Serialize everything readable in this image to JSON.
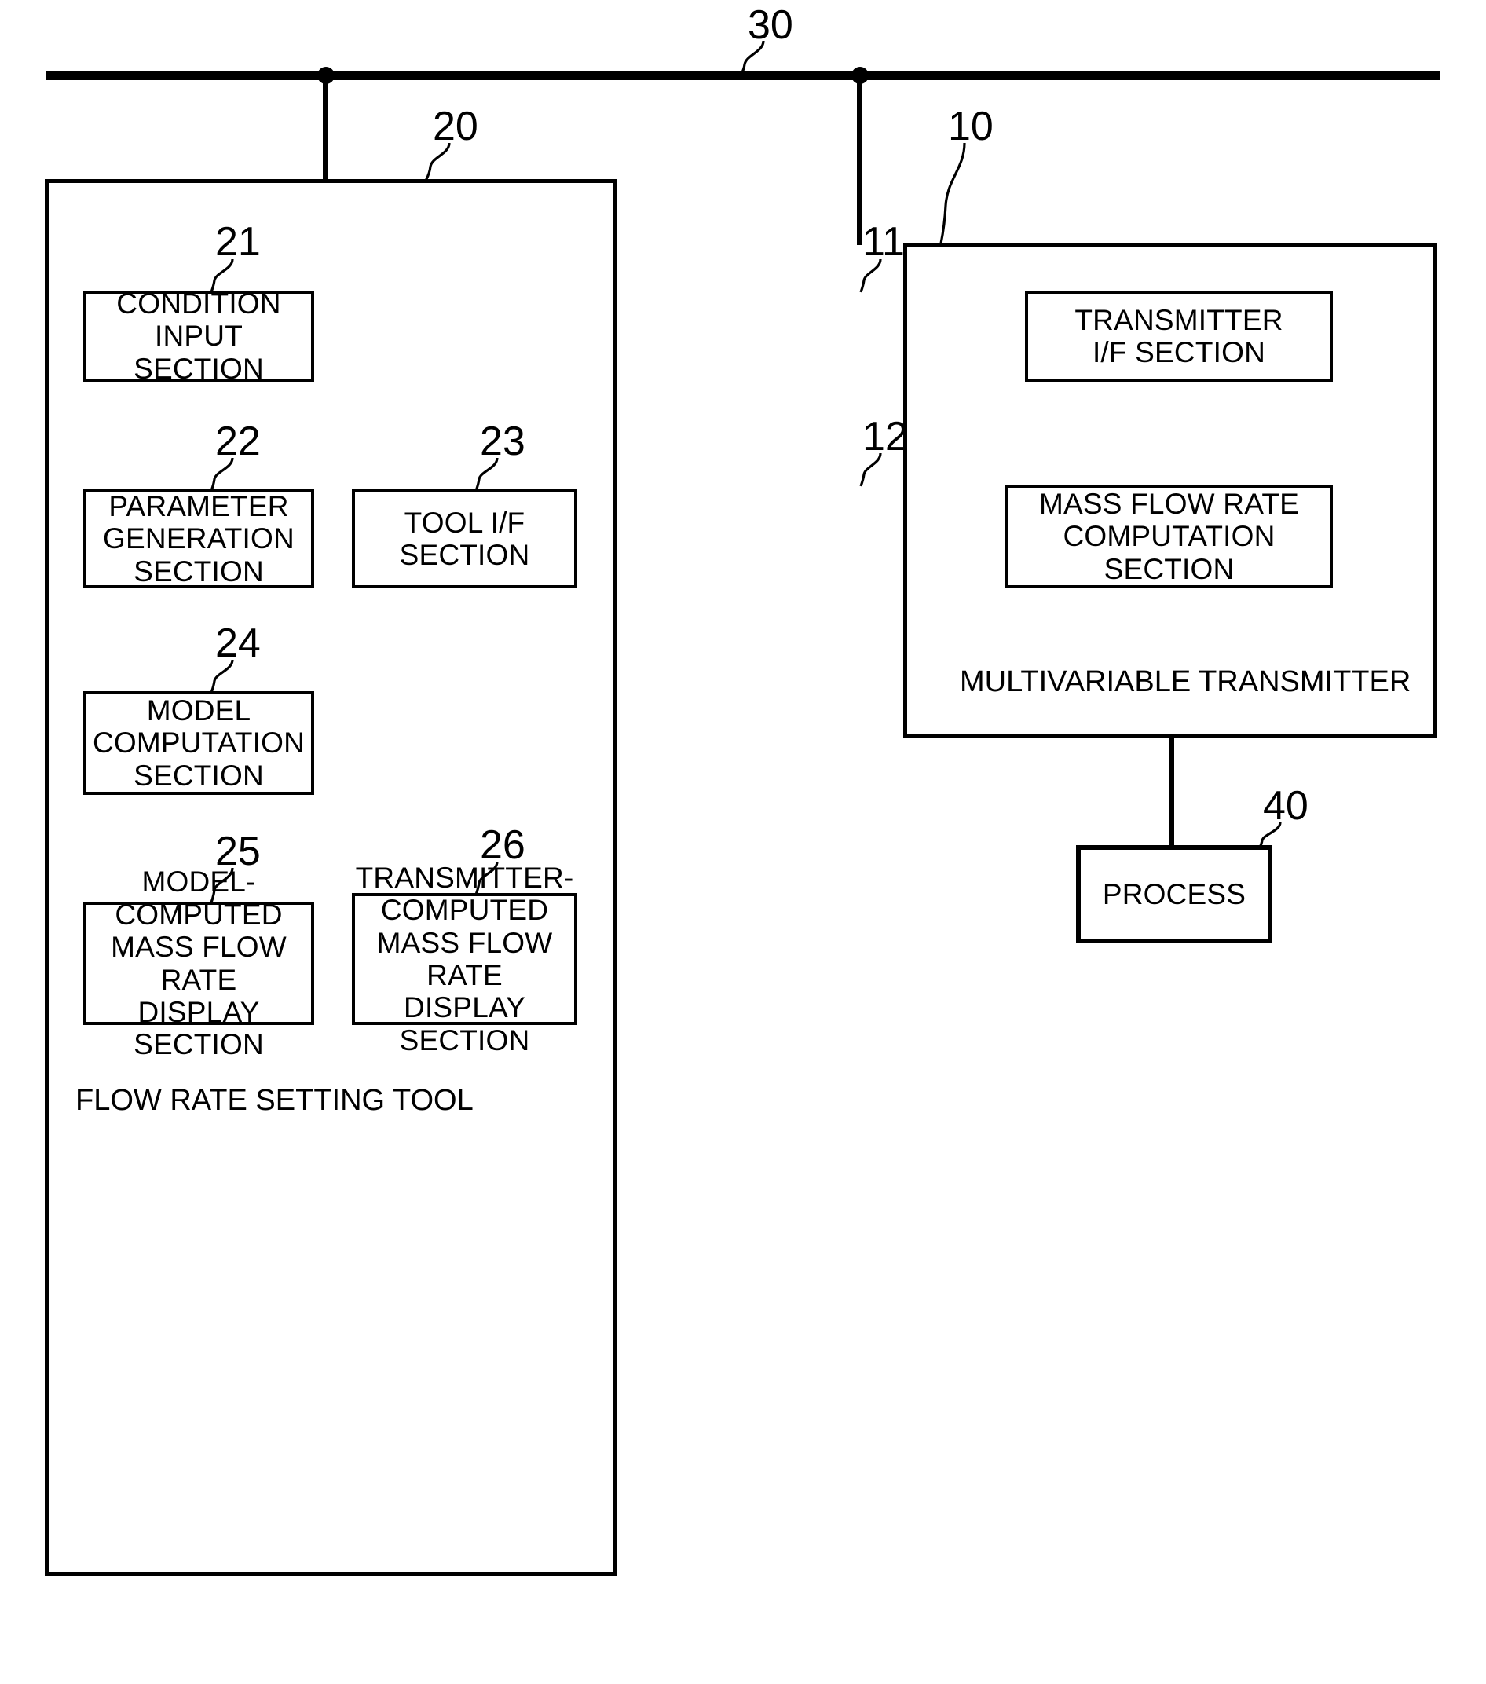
{
  "figure": {
    "bus": {
      "ref": "30"
    },
    "enclosures": [
      {
        "id": "flow-rate-setting-tool",
        "ref": "20",
        "caption": "FLOW RATE SETTING TOOL"
      },
      {
        "id": "multivariable-transmitter",
        "ref": "10",
        "caption": "MULTIVARIABLE TRANSMITTER"
      }
    ],
    "blocks": [
      {
        "id": "condition-input-section",
        "ref": "21",
        "label": "CONDITION\nINPUT SECTION"
      },
      {
        "id": "parameter-generation-section",
        "ref": "22",
        "label": "PARAMETER\nGENERATION\nSECTION"
      },
      {
        "id": "tool-if-section",
        "ref": "23",
        "label": "TOOL I/F SECTION"
      },
      {
        "id": "model-computation-section",
        "ref": "24",
        "label": "MODEL\nCOMPUTATION\nSECTION"
      },
      {
        "id": "model-computed-display-section",
        "ref": "25",
        "label": "MODEL-COMPUTED\nMASS FLOW RATE\nDISPLAY SECTION"
      },
      {
        "id": "transmitter-computed-display-section",
        "ref": "26",
        "label": "TRANSMITTER-\nCOMPUTED\nMASS FLOW RATE\nDISPLAY SECTION"
      },
      {
        "id": "transmitter-if-section",
        "ref": "11",
        "label": "TRANSMITTER\nI/F SECTION"
      },
      {
        "id": "mass-flow-rate-computation-section",
        "ref": "12",
        "label": "MASS FLOW RATE\nCOMPUTATION\nSECTION"
      },
      {
        "id": "process",
        "ref": "40",
        "label": "PROCESS"
      }
    ],
    "colors": {
      "ink": "#000000",
      "paper": "#ffffff"
    }
  }
}
